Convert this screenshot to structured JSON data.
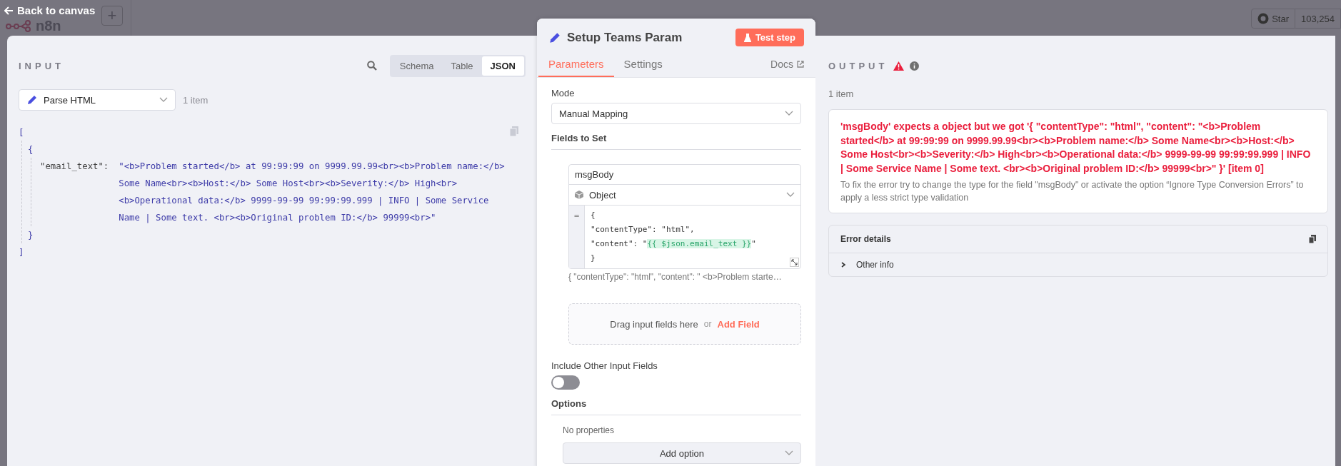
{
  "top_bar": {
    "back_link": "Back to canvas",
    "logo_text": "n8n",
    "add_button": "+",
    "github": {
      "label": "Star",
      "count": "103,254"
    }
  },
  "input": {
    "title": "INPUT",
    "view_tabs": [
      {
        "label": "Schema",
        "selected": false
      },
      {
        "label": "Table",
        "selected": false
      },
      {
        "label": "JSON",
        "selected": true
      }
    ],
    "node_select": "Parse HTML",
    "item_count": "1 item",
    "json": {
      "open_bracket": "[",
      "open_brace": "{",
      "key": "\"email_text\":",
      "value": "\"<b>Problem started</b> at 99:99:99 on 9999.99.99<br><b>Problem name:</b> Some Name<br><b>Host:</b> Some Host<br><b>Severity:</b> High<br><b>Operational data:</b> 9999-99-99 99:99:99.999 | INFO | Some Service Name | Some text. <br><b>Original problem ID:</b> 99999<br>\"",
      "close_brace": "}",
      "close_bracket": "]"
    }
  },
  "node": {
    "title": "Setup Teams Param",
    "test_button": "Test step",
    "tabs": [
      {
        "label": "Parameters",
        "selected": true
      },
      {
        "label": "Settings",
        "selected": false
      }
    ],
    "docs_link": "Docs",
    "mode": {
      "label": "Mode",
      "value": "Manual Mapping"
    },
    "fields_section": "Fields to Set",
    "field": {
      "name": "msgBody",
      "type": "Object",
      "gutter": "=",
      "code_lines": [
        {
          "text": "{"
        },
        {
          "text": "\"contentType\": \"html\","
        },
        {
          "text": "\"content\": \"",
          "expression": "{{ $json.email_text }}",
          "suffix": "\""
        },
        {
          "text": "}"
        }
      ],
      "preview": "{ \"contentType\": \"html\", \"content\": \" <b>Problem starte…"
    },
    "drop_zone": {
      "text": "Drag input fields here",
      "separator": "or",
      "link": "Add Field"
    },
    "include_other": {
      "label": "Include Other Input Fields",
      "on": false
    },
    "options": {
      "title": "Options",
      "empty": "No properties",
      "add_button": "Add option"
    }
  },
  "output": {
    "title": "OUTPUT",
    "item_count": "1 item",
    "error": {
      "message": "'msgBody' expects a object but we got '{ \"contentType\": \"html\", \"content\": \"<b>Problem started</b> at 99:99:99 on 9999.99.99<br><b>Problem name:</b> Some Name<br><b>Host:</b> Some Host<br><b>Severity:</b> High<br><b>Operational data:</b> 9999-99-99 99:99:99.999 | INFO | Some Service Name | Some text. <br><b>Original problem ID:</b> 99999<br>\" }' [item 0]",
      "hint": "To fix the error try to change the type for the field \"msgBody\" or activate the option “Ignore Type Conversion Errors” to apply a less strict type validation"
    },
    "details": {
      "title": "Error details",
      "rows": [
        {
          "label": "Other info",
          "expanded": false
        }
      ]
    }
  }
}
